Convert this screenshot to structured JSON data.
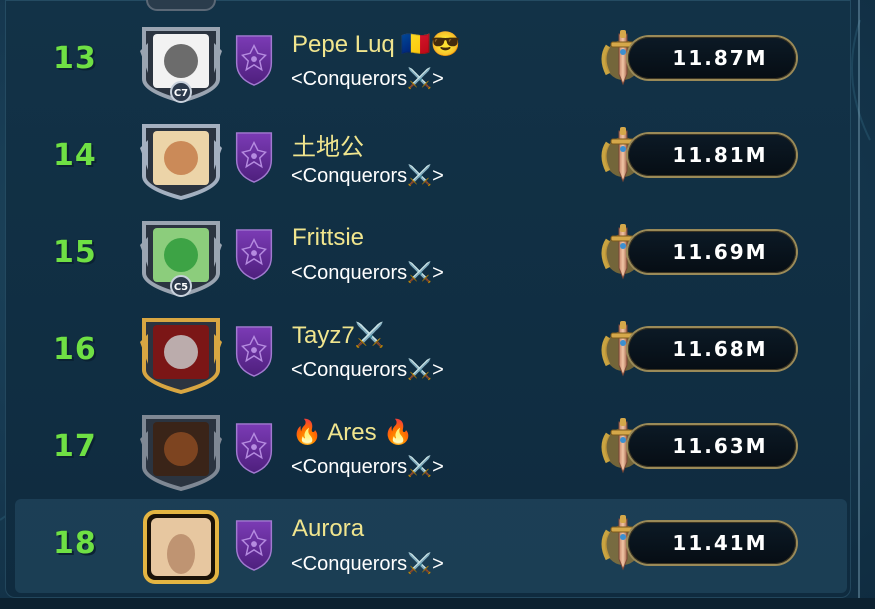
{
  "guild_tag": "<Conquerors⚔️>",
  "rows": [
    {
      "rank": "13",
      "name": "Pepe Luq",
      "name_emojis": "🇷🇴😎",
      "power": "11.87M",
      "frame": "silver",
      "level_badge": "C7"
    },
    {
      "rank": "14",
      "name": "土地公",
      "name_emojis": "",
      "power": "11.81M",
      "frame": "silver-wing",
      "level_badge": ""
    },
    {
      "rank": "15",
      "name": "Frittsie",
      "name_emojis": "",
      "power": "11.69M",
      "frame": "silver",
      "level_badge": "C5"
    },
    {
      "rank": "16",
      "name": "Tayz7⚔️",
      "name_emojis": "",
      "power": "11.68M",
      "frame": "gold",
      "level_badge": ""
    },
    {
      "rank": "17",
      "name": "🔥 Ares 🔥",
      "name_emojis": "",
      "power": "11.63M",
      "frame": "dark",
      "level_badge": ""
    },
    {
      "rank": "18",
      "name": "Aurora",
      "name_emojis": "",
      "power": "11.41M",
      "frame": "gold-square",
      "level_badge": ""
    }
  ],
  "colors": {
    "rank": "#6fe044",
    "name": "#f0e58e",
    "guild_shield": "#6a2d9e",
    "pill_border": "#9a8a58"
  },
  "icons": {
    "power": "sword-laurel-icon",
    "guild": "purple-shield-icon",
    "swords": "crossed-swords-icon"
  }
}
